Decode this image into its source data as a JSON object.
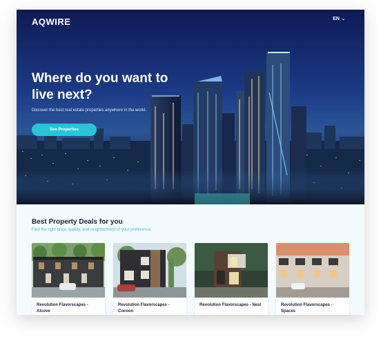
{
  "brand": {
    "logo": "AQWIRE"
  },
  "nav": {
    "language": "EN",
    "language_icon": "chevron-down-icon"
  },
  "hero": {
    "title": "Where do you want to live next?",
    "subtitle": "Discover the best real estate properties anywhere in the world.",
    "cta_label": "See Properties"
  },
  "deals": {
    "title": "Best Property Deals for you",
    "subtitle": "Find the right price, quality, and neighborhood of your preference.",
    "items": [
      {
        "name": "Revolution Flavorscapes - Alcove"
      },
      {
        "name": "Revolution Flavorscapes - Cocoon"
      },
      {
        "name": "Revolution Flavorscapes - Nest"
      },
      {
        "name": "Revolution Flavorscapes - Spaces"
      }
    ]
  },
  "colors": {
    "accent": "#27c5d6",
    "heading": "#1a1f36",
    "subtext": "#4fb4c9",
    "hero_bg": "#1c3a86"
  }
}
